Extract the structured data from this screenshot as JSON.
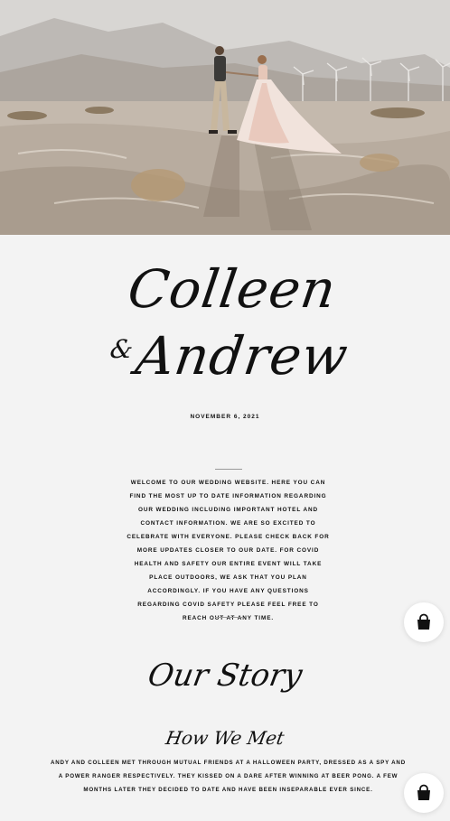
{
  "hero": {
    "image": "couple-in-desert-photo"
  },
  "couple": {
    "first_name": "Colleen",
    "ampersand": "&",
    "second_name": "Andrew"
  },
  "event": {
    "date": "NOVEMBER 6, 2021"
  },
  "welcome": {
    "text": "Welcome to our wedding website. Here you can find the most up to date information regarding our wedding including important hotel and contact information. We are so excited to celebrate with everyone. Please check back for more updates closer to our date. For covid health and safety our entire event will take place outdoors, we ask that you plan accordingly. If you have any questions regarding covid safety please feel free to reach out at any time."
  },
  "story": {
    "title": "Our Story",
    "how_we_met_title": "How We Met",
    "how_we_met_text": "Andy and Colleen met through mutual friends at a Halloween party, dressed as a spy and a Power Ranger respectively. They kissed on a dare after winning at beer pong. A few months later they decided to date and have been inseparable ever since."
  },
  "actions": {
    "cart_icon": "shopping-bag-icon"
  }
}
